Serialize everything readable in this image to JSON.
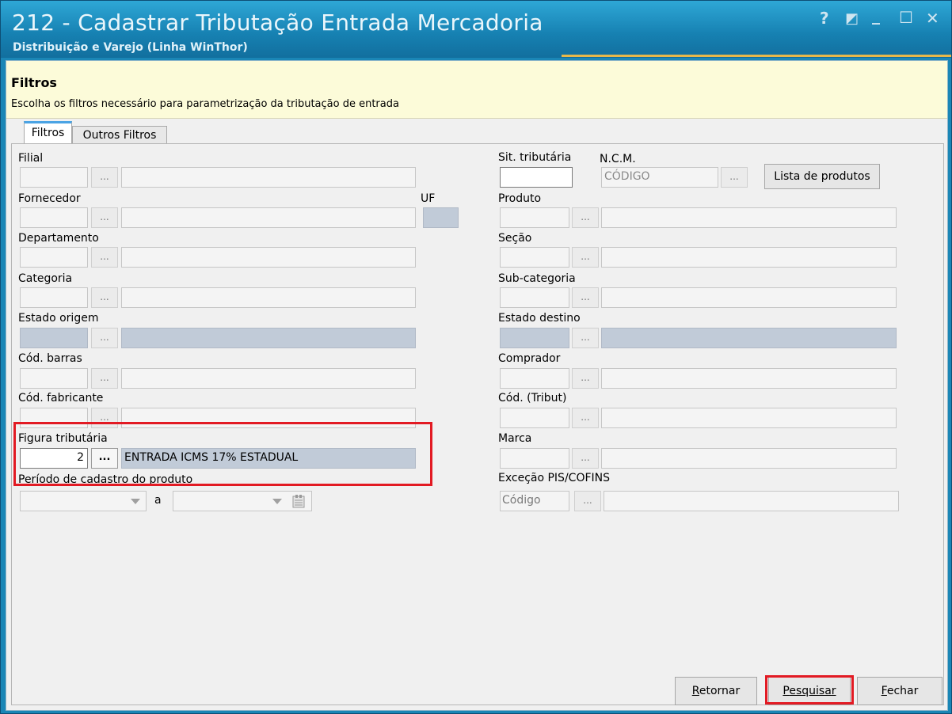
{
  "window": {
    "title": "212 - Cadastrar Tributação Entrada Mercadoria",
    "subtitle": "Distribuição e Varejo (Linha WinThor)",
    "controls": {
      "help": "?",
      "restore_alt": "◩",
      "minimize": "_",
      "maximize": "☐",
      "close": "✕"
    }
  },
  "header": {
    "title": "Filtros",
    "description": "Escolha os filtros necessário para parametrização da tributação de entrada"
  },
  "tabs": [
    {
      "label": "Filtros",
      "active": true
    },
    {
      "label": "Outros Filtros",
      "active": false
    }
  ],
  "left": {
    "filial": "Filial",
    "fornecedor": "Fornecedor",
    "uf": "UF",
    "departamento": "Departamento",
    "categoria": "Categoria",
    "estado_origem": "Estado origem",
    "cod_barras": "Cód. barras",
    "cod_fabricante": "Cód. fabricante",
    "figura_tributaria": {
      "label": "Figura tributária",
      "code": "2",
      "description": "ENTRADA ICMS 17% ESTADUAL"
    },
    "periodo": {
      "label": "Período de cadastro do produto",
      "separator": "a"
    }
  },
  "right": {
    "sit_tributaria": "Sit. tributária",
    "ncm": {
      "label": "N.C.M.",
      "placeholder": "CÓDIGO"
    },
    "lista_produtos": "Lista de produtos",
    "produto": "Produto",
    "secao": "Seção",
    "sub_categoria": "Sub-categoria",
    "estado_destino": "Estado destino",
    "comprador": "Comprador",
    "cod_tribut": "Cód. (Tribut)",
    "marca": "Marca",
    "excecao": {
      "label": "Exceção PIS/COFINS",
      "placeholder": "Código"
    }
  },
  "ellipsis": "...",
  "buttons": {
    "retornar": {
      "first": "R",
      "rest": "etornar"
    },
    "pesquisar": {
      "first": "P",
      "rest": "esquisar"
    },
    "fechar": {
      "first": "F",
      "rest": "echar"
    }
  },
  "colors": {
    "accent": "#1a86b6",
    "highlight": "#e21a23",
    "header_bg": "#fcfbd9"
  }
}
